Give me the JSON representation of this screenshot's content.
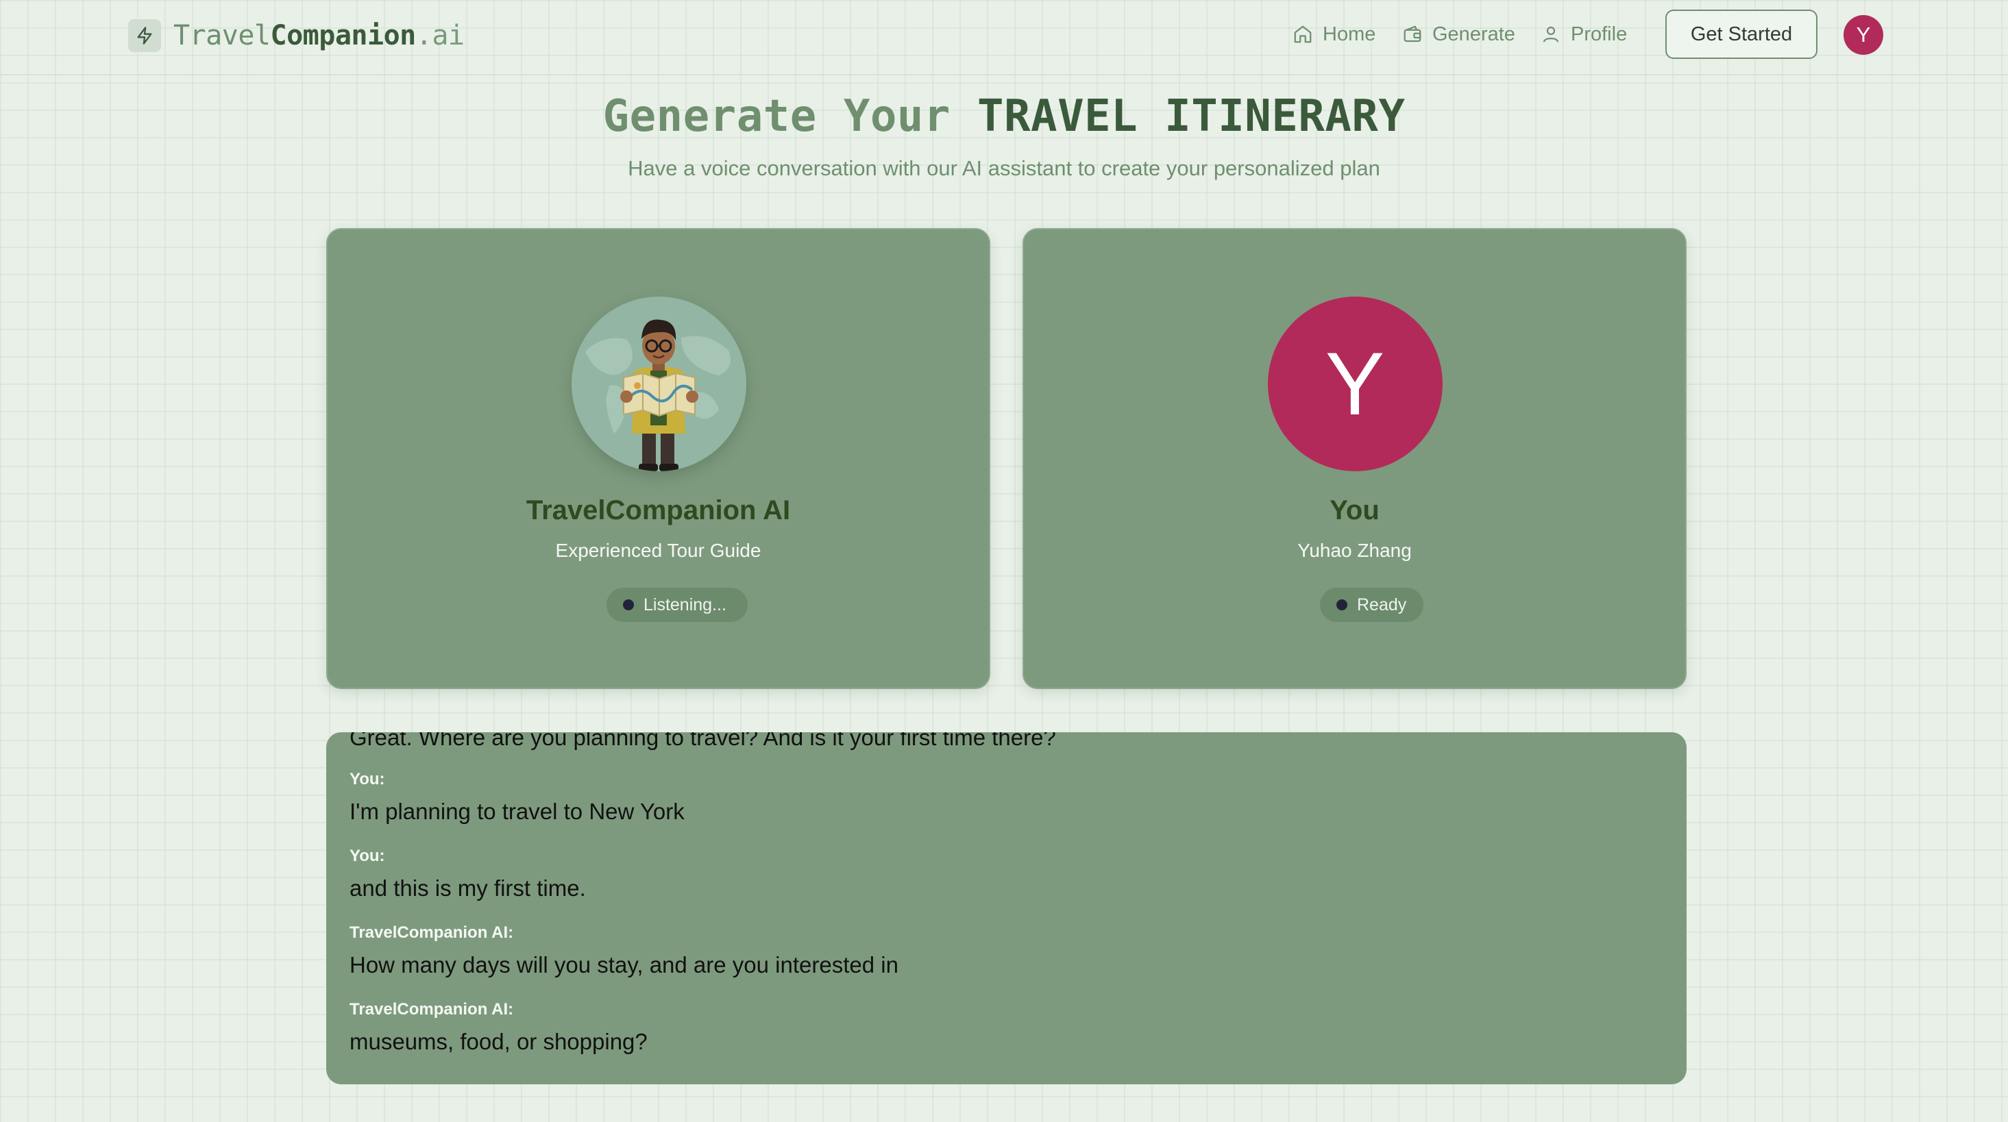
{
  "nav": {
    "logo_parts": [
      "Travel",
      "Companion",
      ".ai"
    ],
    "logo_icon": "lightning-icon",
    "links": [
      {
        "label": "Home",
        "icon": "home-icon"
      },
      {
        "label": "Generate",
        "icon": "wallet-icon"
      },
      {
        "label": "Profile",
        "icon": "user-icon"
      }
    ],
    "cta_label": "Get Started",
    "avatar_initial": "Y"
  },
  "hero": {
    "title_prefix": "Generate Your",
    "title_highlight": "TRAVEL ITINERARY",
    "subtitle": "Have a voice conversation with our AI assistant to create your personalized plan"
  },
  "ai_card": {
    "name": "TravelCompanion AI",
    "role": "Experienced Tour Guide",
    "status": "Listening..."
  },
  "user_card": {
    "initial": "Y",
    "name": "You",
    "full_name": "Yuhao Zhang",
    "status": "Ready"
  },
  "transcript": {
    "partial_text": "Great. Where are you planning to travel? And is it your first time there?",
    "messages": [
      {
        "speaker": "You:",
        "text": "I'm planning to travel to New York"
      },
      {
        "speaker": "You:",
        "text": "and this is my first time."
      },
      {
        "speaker": "TravelCompanion AI:",
        "text": "How many days will you stay, and are you interested in"
      },
      {
        "speaker": "TravelCompanion AI:",
        "text": "museums, food, or shopping?"
      }
    ]
  },
  "colors": {
    "background": "#e8f0e8",
    "card": "#7e9a7e",
    "accent_dark": "#3b5a3b",
    "avatar": "#b22a5a"
  }
}
